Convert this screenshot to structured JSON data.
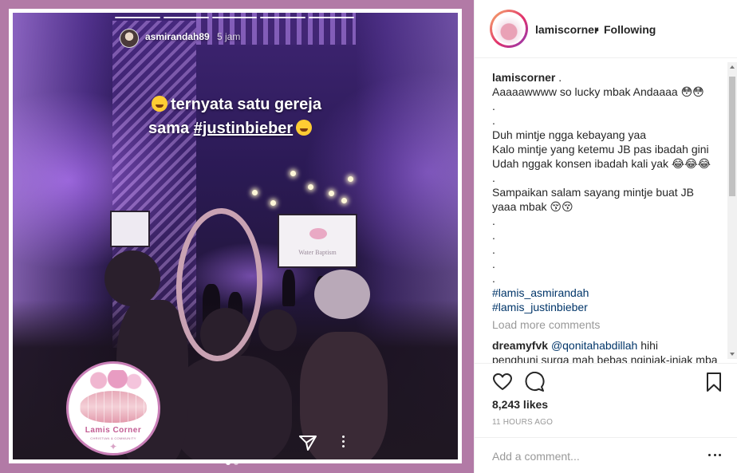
{
  "story": {
    "username": "asmirandah89",
    "time": "5 jam",
    "caption_line1": "ternyata satu gereja",
    "caption_line2_prefix": "sama ",
    "caption_hashtag": "#justinbieber",
    "screen_text": "Water Baptism",
    "logo_name": "Lamis Corner",
    "logo_tagline": "CHRISTIAN & COMMUNITY",
    "progress_segments": 5
  },
  "header": {
    "username": "lamiscorner",
    "separator": "•",
    "follow_status": "Following"
  },
  "post": {
    "author": "lamiscorner",
    "author_suffix": " .",
    "caption_lines": [
      "Aaaaawwww so lucky mbak Andaaaa 😳😳",
      ".",
      ".",
      "Duh mintje ngga kebayang yaa",
      "Kalo mintje yang ketemu JB pas ibadah gini",
      "Udah nggak konsen ibadah kali yak 😂😂😂",
      ".",
      "Sampaikan salam sayang mintje buat JB",
      "yaaa mbak 😚😚",
      ".",
      ".",
      ".",
      ".",
      "."
    ],
    "hashtags": [
      "#lamis_asmirandah",
      "#lamis_justinbieber"
    ],
    "load_more": "Load more comments",
    "comment": {
      "user": "dreamyfvk",
      "mention": "@qonitahabdillah",
      "text": " hihi",
      "cutoff_line": "penghuni surga mah bebas nginjak-injak mba"
    }
  },
  "actions": {
    "like_icon": "heart-icon",
    "comment_icon": "comment-icon",
    "save_icon": "bookmark-icon",
    "likes": "8,243 likes",
    "time_ago": "11 HOURS AGO"
  },
  "add_comment": {
    "placeholder": "Add a comment...",
    "value": ""
  },
  "colors": {
    "photo_border": "#b27aa6",
    "hashtag_link": "#003569",
    "muted_text": "#999999",
    "ring_gradient_start": "#f7b26a",
    "ring_gradient_end": "#8a3ab9"
  }
}
